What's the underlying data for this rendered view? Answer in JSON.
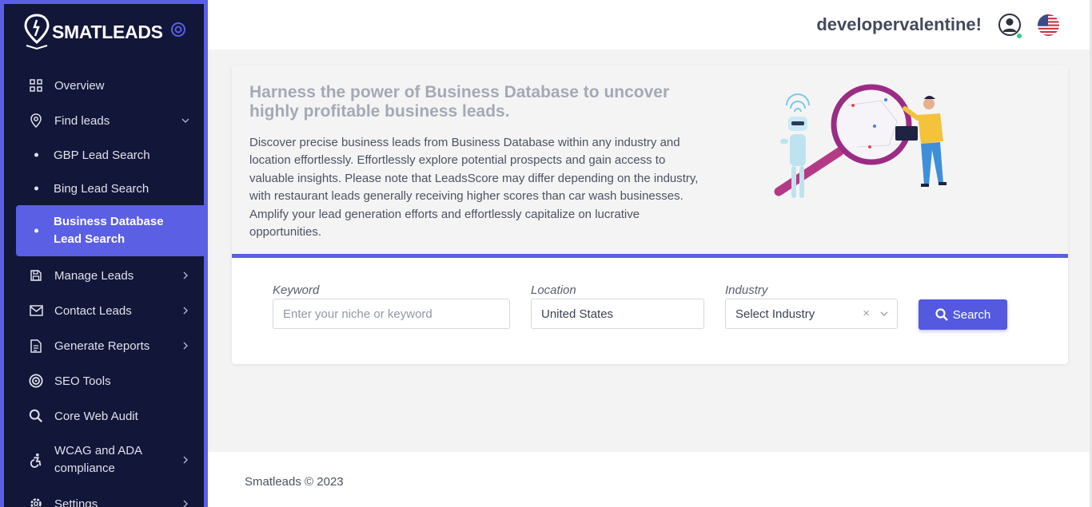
{
  "brand": {
    "name": "SMATLEADS",
    "logo_icon": "location-pin-icon",
    "toggle_icon": "target-toggle-icon"
  },
  "sidebar": {
    "items": [
      {
        "label": "Overview",
        "icon": "grid-icon"
      },
      {
        "label": "Find leads",
        "icon": "map-pin-icon"
      },
      {
        "label": "GBP Lead Search"
      },
      {
        "label": "Bing Lead Search"
      },
      {
        "label": "Business Database Lead Search"
      },
      {
        "label": "Manage Leads",
        "icon": "save-icon"
      },
      {
        "label": "Contact Leads",
        "icon": "mail-icon"
      },
      {
        "label": "Generate Reports",
        "icon": "document-icon"
      },
      {
        "label": "SEO Tools",
        "icon": "target-icon"
      },
      {
        "label": "Core Web Audit",
        "icon": "search-icon"
      },
      {
        "label": "WCAG and ADA compliance",
        "icon": "accessibility-icon"
      },
      {
        "label": "Settings",
        "icon": "gear-icon"
      }
    ],
    "active_color": "#5b5fe3",
    "background_color": "#121638"
  },
  "header": {
    "username": "developervalentine!",
    "status_color": "#2fd285"
  },
  "hero": {
    "title": "Harness the power of Business Database to uncover highly profitable business leads.",
    "description": "Discover precise business leads from Business Database within any industry and location effortlessly. Effortlessly explore potential prospects and gain access to valuable insights. Please note that LeadsScore may differ depending on the industry, with restaurant leads generally receiving higher scores than car wash businesses. Amplify your lead generation efforts and effortlessly capitalize on lucrative opportunities."
  },
  "form": {
    "keyword": {
      "label": "Keyword",
      "value": "",
      "placeholder": "Enter your niche or keyword"
    },
    "location": {
      "label": "Location",
      "value": "United States"
    },
    "industry": {
      "label": "Industry",
      "selected": "Select Industry",
      "clear": "×"
    },
    "search_button": "Search"
  },
  "footer": {
    "text": "Smatleads © 2023"
  }
}
